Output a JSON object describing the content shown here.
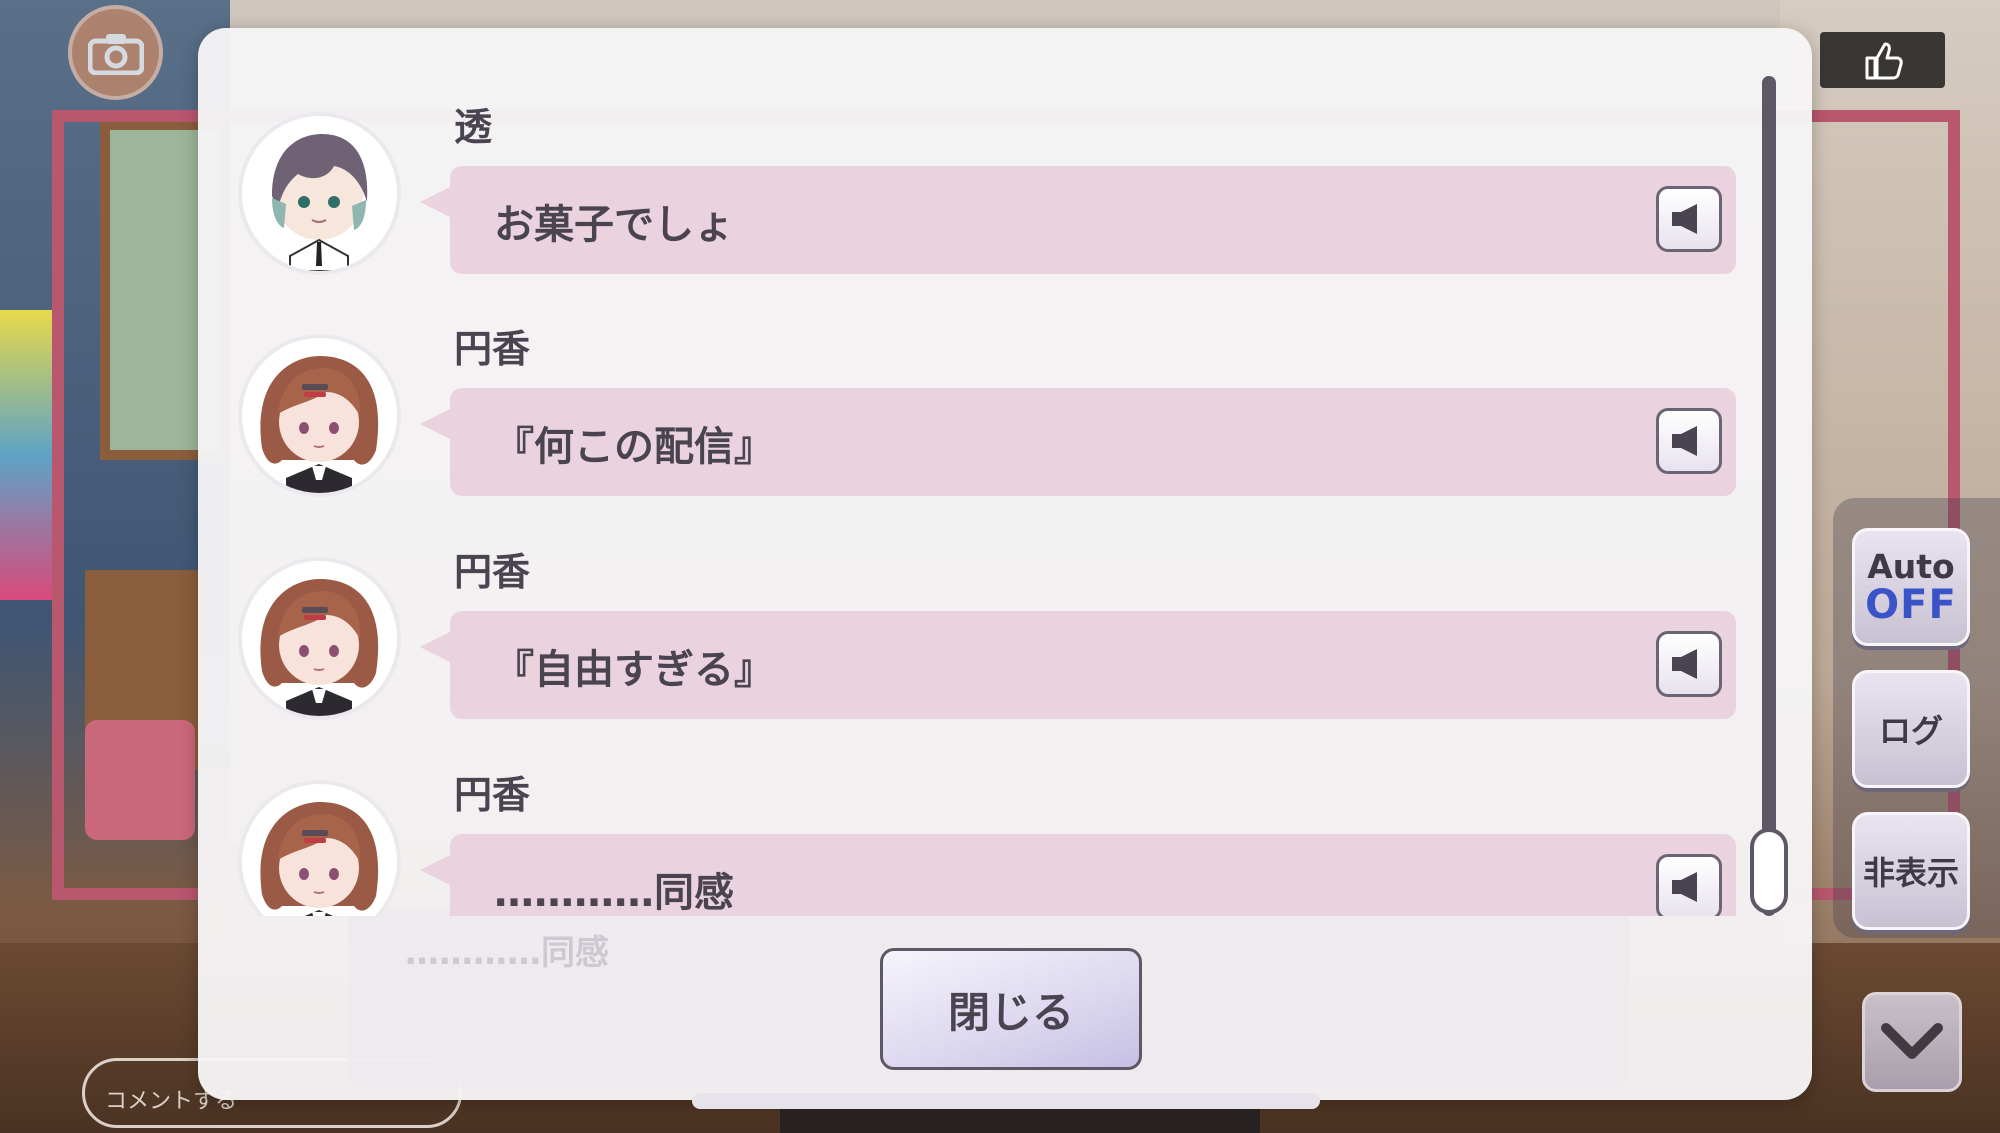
{
  "background": {
    "comment_button_label": "コメントする",
    "accent_frame_color": "#b9576f"
  },
  "side_menu": {
    "auto_label": "Auto",
    "auto_state": "OFF",
    "log_label": "ログ",
    "hide_label": "非表示"
  },
  "log": {
    "entries": [
      {
        "speaker": "透",
        "text": "お菓子でしょ",
        "avatar": "toru-avatar"
      },
      {
        "speaker": "円香",
        "text": "『何この配信』",
        "avatar": "madoka-avatar"
      },
      {
        "speaker": "円香",
        "text": "『自由すぎる』",
        "avatar": "madoka-avatar"
      },
      {
        "speaker": "円香",
        "text": "…………同感",
        "avatar": "madoka-avatar"
      }
    ],
    "ghost_text": "…………同感",
    "close_label": "閉じる"
  },
  "icons": {
    "camera": "camera-icon",
    "like": "thumbs-up-icon",
    "voice": "speaker-icon",
    "down": "chevron-down-icon"
  }
}
